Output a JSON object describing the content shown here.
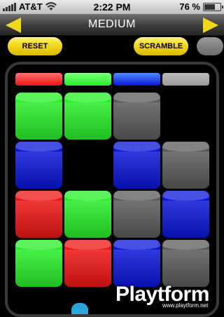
{
  "status_bar": {
    "carrier": "AT&T",
    "time": "2:22 PM",
    "battery_text": "76 %",
    "battery_level_percent": 76
  },
  "nav": {
    "title": "MEDIUM",
    "prev_icon": "arrow-left-icon",
    "next_icon": "arrow-right-icon"
  },
  "controls": {
    "reset_label": "RESET",
    "scramble_label": "SCRAMBLE"
  },
  "colors": {
    "green": "#26ee26",
    "blue": "#0a16d8",
    "red": "#ee1515",
    "gray": "#5a5a5a",
    "accent_yellow": "#f2d81a"
  },
  "target_row": [
    "red",
    "green",
    "blue",
    "gray"
  ],
  "grid": [
    [
      "green",
      "green",
      "gray",
      "empty"
    ],
    [
      "blue",
      "empty",
      "blue",
      "gray"
    ],
    [
      "red",
      "green",
      "gray",
      "blue"
    ],
    [
      "green",
      "red",
      "blue",
      "gray"
    ]
  ],
  "watermark": {
    "brand": "Playtform",
    "url": "www.playtform.net"
  }
}
